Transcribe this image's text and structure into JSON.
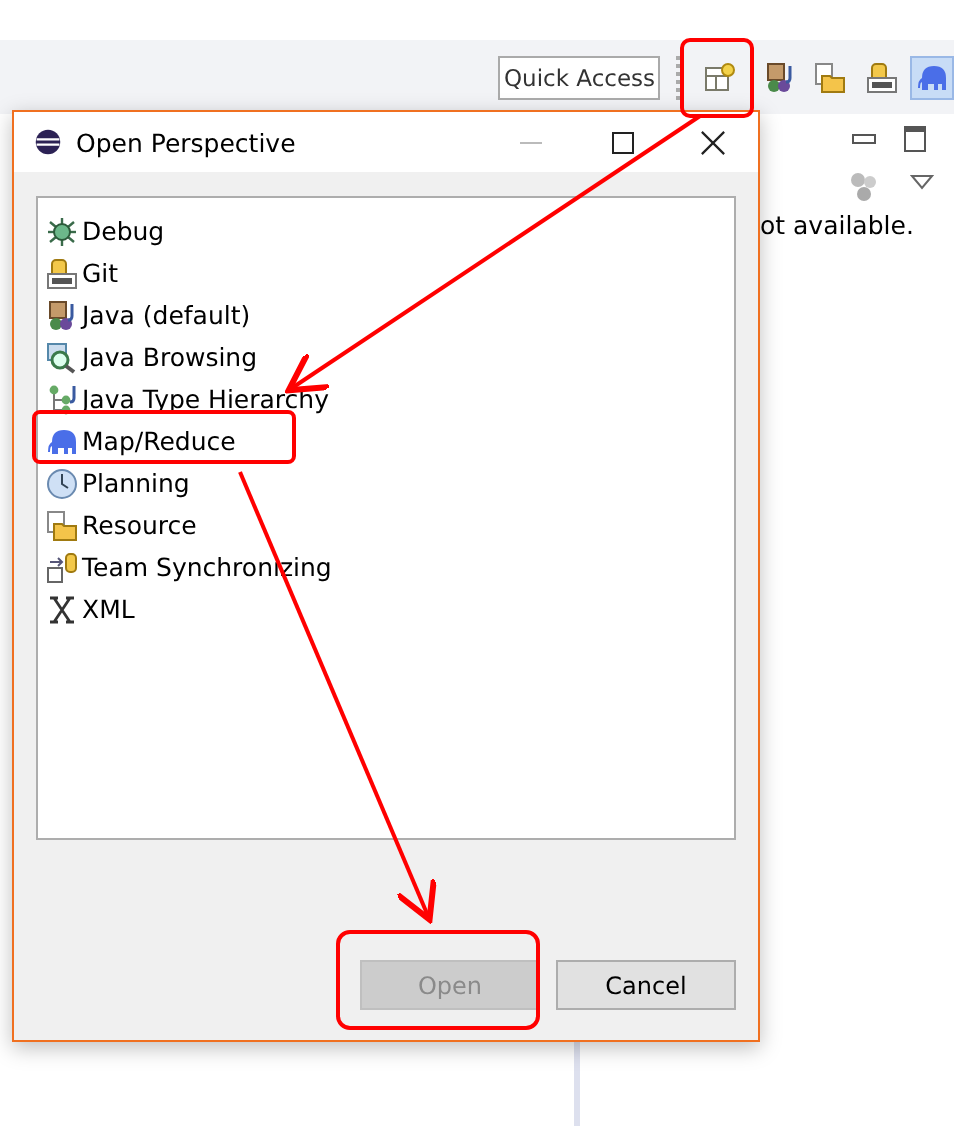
{
  "toolbar": {
    "quick_access": {
      "placeholder": "Quick Access"
    },
    "perspective_buttons": [
      {
        "kind": "open-perspective",
        "selected": false
      },
      {
        "kind": "java",
        "selected": false
      },
      {
        "kind": "resource",
        "selected": false
      },
      {
        "kind": "git",
        "selected": false
      },
      {
        "kind": "elephant",
        "selected": true
      }
    ]
  },
  "background_view": {
    "message": "ot available."
  },
  "dialog": {
    "title": "Open Perspective",
    "perspectives": [
      {
        "label": "Debug",
        "kind": "debug"
      },
      {
        "label": "Git",
        "kind": "git"
      },
      {
        "label": "Java (default)",
        "kind": "java"
      },
      {
        "label": "Java Browsing",
        "kind": "browsing"
      },
      {
        "label": "Java Type Hierarchy",
        "kind": "hierarchy"
      },
      {
        "label": "Map/Reduce",
        "kind": "elephant"
      },
      {
        "label": "Planning",
        "kind": "planning"
      },
      {
        "label": "Resource",
        "kind": "resource"
      },
      {
        "label": "Team Synchronizing",
        "kind": "team"
      },
      {
        "label": "XML",
        "kind": "xml"
      }
    ],
    "buttons": [
      {
        "label": "Open",
        "disabled": true
      },
      {
        "label": "Cancel",
        "disabled": false
      }
    ]
  }
}
